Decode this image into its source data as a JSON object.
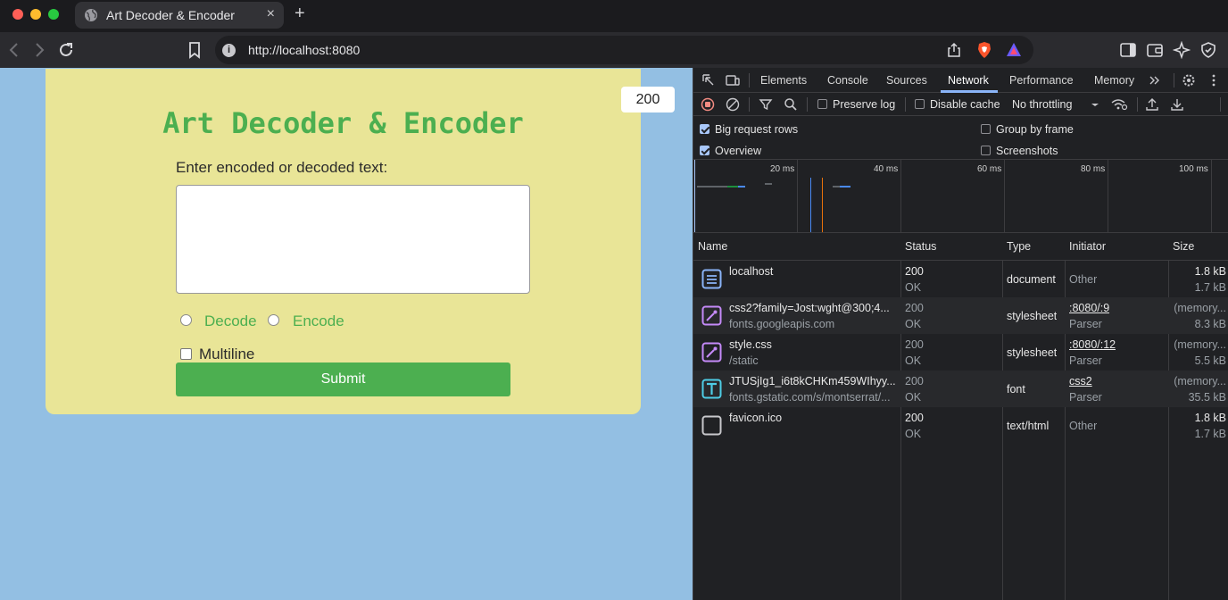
{
  "window": {
    "tab_title": "Art Decoder & Encoder",
    "tab_close": "×",
    "new_tab": "+",
    "url": "http://localhost:8080",
    "info_glyph": "i"
  },
  "page": {
    "title": "Art Decoder & Encoder",
    "prompt": "Enter encoded or decoded text:",
    "textarea_value": "",
    "radio_decode": "Decode",
    "radio_encode": "Encode",
    "multiline_label": "Multiline",
    "submit_label": "Submit",
    "status_badge": "200",
    "accent_color": "#4caf50"
  },
  "devtools": {
    "tabs": [
      "Elements",
      "Console",
      "Sources",
      "Network",
      "Performance",
      "Memory"
    ],
    "active_tab": "Network",
    "toolbar": {
      "preserve_log": "Preserve log",
      "disable_cache": "Disable cache",
      "throttling": "No throttling"
    },
    "settings": {
      "big_request_rows": "Big request rows",
      "overview": "Overview",
      "group_by_frame": "Group by frame",
      "screenshots": "Screenshots"
    },
    "overview_ticks": [
      "20 ms",
      "40 ms",
      "60 ms",
      "80 ms",
      "100 ms"
    ],
    "columns": [
      "Name",
      "Status",
      "Type",
      "Initiator",
      "Size"
    ],
    "requests": [
      {
        "name": "localhost",
        "sub": "",
        "status": "200",
        "status_text": "OK",
        "type": "document",
        "initiator": "Other",
        "initiator_sub": "",
        "size": "1.8 kB",
        "size_sub": "1.7 kB",
        "icon": "document-icon"
      },
      {
        "name": "css2?family=Jost:wght@300;4...",
        "sub": "fonts.googleapis.com",
        "status": "200",
        "status_text": "OK",
        "type": "stylesheet",
        "initiator": ":8080/:9",
        "initiator_sub": "Parser",
        "size": "(memory...",
        "size_sub": "8.3 kB",
        "icon": "stylesheet-icon"
      },
      {
        "name": "style.css",
        "sub": "/static",
        "status": "200",
        "status_text": "OK",
        "type": "stylesheet",
        "initiator": ":8080/:12",
        "initiator_sub": "Parser",
        "size": "(memory...",
        "size_sub": "5.5 kB",
        "icon": "stylesheet-icon"
      },
      {
        "name": "JTUSjIg1_i6t8kCHKm459WIhyy...",
        "sub": "fonts.gstatic.com/s/montserrat/...",
        "status": "200",
        "status_text": "OK",
        "type": "font",
        "initiator": "css2",
        "initiator_sub": "Parser",
        "size": "(memory...",
        "size_sub": "35.5 kB",
        "icon": "font-icon"
      },
      {
        "name": "favicon.ico",
        "sub": "",
        "status": "200",
        "status_text": "OK",
        "type": "text/html",
        "initiator": "Other",
        "initiator_sub": "",
        "size": "1.8 kB",
        "size_sub": "1.7 kB",
        "icon": "blank-file-icon"
      }
    ]
  }
}
